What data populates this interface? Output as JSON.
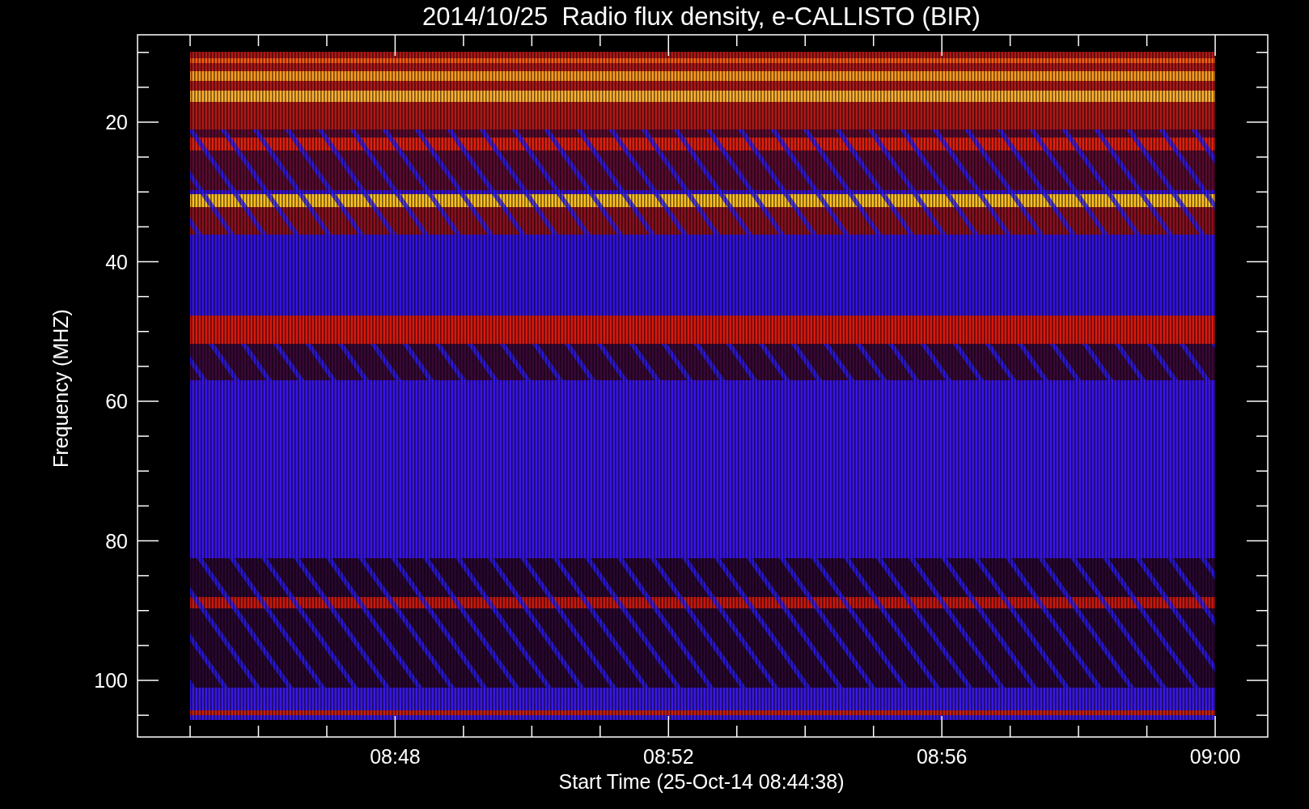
{
  "title": "2014/10/25  Radio flux density, e-CALLISTO (BIR)",
  "y_axis": {
    "label": "Frequency (MHZ)",
    "ticks": [
      "20",
      "40",
      "60",
      "80",
      "100"
    ]
  },
  "x_axis": {
    "label": "Start Time (25-Oct-14 08:44:38)",
    "ticks": [
      "08:48",
      "08:52",
      "08:56",
      "09:00"
    ]
  }
}
